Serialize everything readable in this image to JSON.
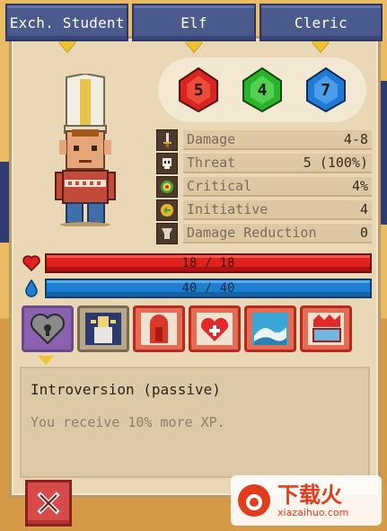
{
  "tabs": [
    {
      "label": "Exch. Student"
    },
    {
      "label": "Elf"
    },
    {
      "label": "Cleric"
    }
  ],
  "dice": [
    {
      "value": "5",
      "color": "#d8261e"
    },
    {
      "value": "4",
      "color": "#2bb42b"
    },
    {
      "value": "7",
      "color": "#1f7ad6"
    }
  ],
  "stats": [
    {
      "icon": "sword-icon",
      "label": "Damage",
      "value": "4-8"
    },
    {
      "icon": "skull-icon",
      "label": "Threat",
      "value": "5 (100%)"
    },
    {
      "icon": "target-icon",
      "label": "Critical",
      "value": "4%"
    },
    {
      "icon": "initiative-icon",
      "label": "Initiative",
      "value": "4"
    },
    {
      "icon": "shield-anvil-icon",
      "label": "Damage Reduction",
      "value": "0"
    }
  ],
  "health": {
    "text": "18 / 18",
    "fraction": 1.0,
    "icon": "heart-icon"
  },
  "mana": {
    "text": "40 / 40",
    "fraction": 1.0,
    "icon": "drop-icon"
  },
  "skills": [
    {
      "icon": "introversion-icon"
    },
    {
      "icon": "elf-portrait-icon"
    },
    {
      "icon": "statue-icon"
    },
    {
      "icon": "heart-heal-icon"
    },
    {
      "icon": "wave-icon"
    },
    {
      "icon": "crown-scroll-icon"
    }
  ],
  "description": {
    "title": "Introversion (passive)",
    "text": "You receive 10% more XP."
  },
  "watermark": {
    "main": "下载火",
    "sub": "xiazaihuo.com"
  }
}
